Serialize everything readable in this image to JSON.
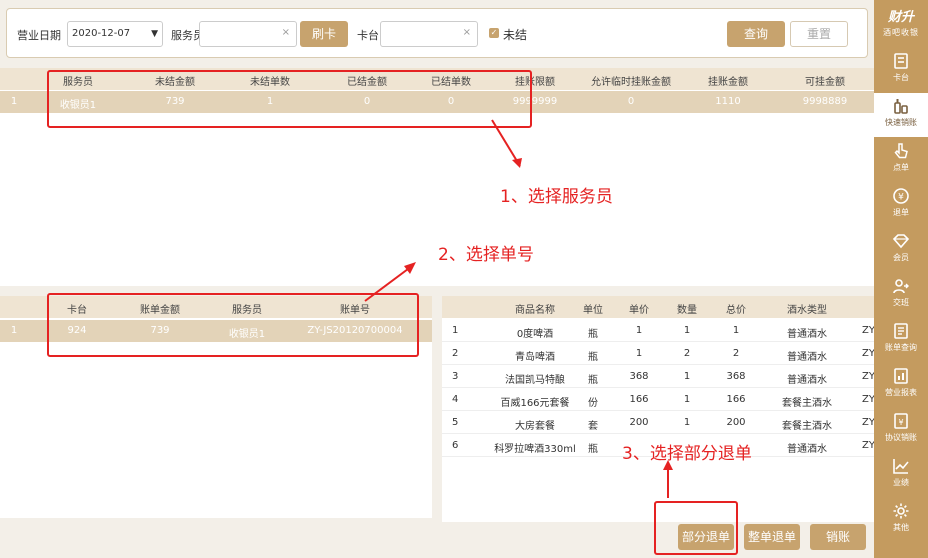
{
  "filter": {
    "date_label": "营业日期",
    "date_value": "2020-12-07",
    "waiter_label": "服务员",
    "waiter_clear": "×",
    "swipe_label": "刷卡",
    "card_label": "卡台",
    "card_clear": "×",
    "unsettled_label": "未结",
    "query_label": "查询",
    "reset_label": "重置"
  },
  "waiter_table": {
    "headers": [
      "服务员",
      "未结金额",
      "未结单数",
      "已结金额",
      "已结单数",
      "挂账限额",
      "允许临时挂账金额",
      "挂账金额",
      "可挂金额"
    ],
    "rows": [
      {
        "no": "1",
        "cells": [
          "收银员1",
          "739",
          "1",
          "0",
          "0",
          "9999999",
          "0",
          "1110",
          "9998889"
        ]
      }
    ]
  },
  "bill_table": {
    "headers": [
      "卡台",
      "账单金额",
      "服务员",
      "账单号"
    ],
    "rows": [
      {
        "no": "1",
        "cells": [
          "924",
          "739",
          "收银员1",
          "ZY-JS20120700004"
        ]
      }
    ]
  },
  "item_table": {
    "headers": [
      "商品名称",
      "单位",
      "单价",
      "数量",
      "总价",
      "酒水类型"
    ],
    "rows": [
      {
        "no": "1",
        "cells": [
          "0度啤酒",
          "瓶",
          "1",
          "1",
          "1",
          "普通酒水"
        ],
        "tail": "ZY"
      },
      {
        "no": "2",
        "cells": [
          "青岛啤酒",
          "瓶",
          "1",
          "2",
          "2",
          "普通酒水"
        ],
        "tail": "ZY"
      },
      {
        "no": "3",
        "cells": [
          "法国凯马特酿",
          "瓶",
          "368",
          "1",
          "368",
          "普通酒水"
        ],
        "tail": "ZY"
      },
      {
        "no": "4",
        "cells": [
          "百威166元套餐",
          "份",
          "166",
          "1",
          "166",
          "套餐主酒水"
        ],
        "tail": "ZY"
      },
      {
        "no": "5",
        "cells": [
          "大房套餐",
          "套",
          "200",
          "1",
          "200",
          "套餐主酒水"
        ],
        "tail": "ZY"
      },
      {
        "no": "6",
        "cells": [
          "科罗拉啤酒330ml",
          "瓶",
          "",
          "",
          "",
          "普通酒水"
        ],
        "tail": "ZY"
      }
    ]
  },
  "actions": {
    "partial_refund": "部分退单",
    "full_refund": "整单退单",
    "sell_off": "销账"
  },
  "sidebar": {
    "brand": "财升",
    "brand_sub": "酒吧收银",
    "items": [
      {
        "label": "卡台",
        "icon": "table-icon"
      },
      {
        "label": "快速销账",
        "icon": "bottles-icon"
      },
      {
        "label": "点单",
        "icon": "hand-pointer-icon"
      },
      {
        "label": "退单",
        "icon": "refund-yen-icon"
      },
      {
        "label": "会员",
        "icon": "diamond-icon"
      },
      {
        "label": "交班",
        "icon": "shift-users-icon"
      },
      {
        "label": "账单查询",
        "icon": "bill-query-icon"
      },
      {
        "label": "营业报表",
        "icon": "report-icon"
      },
      {
        "label": "协议销账",
        "icon": "agreement-yen-icon"
      },
      {
        "label": "业绩",
        "icon": "trend-chart-icon"
      },
      {
        "label": "其他",
        "icon": "gear-icon"
      }
    ],
    "active_index": 1
  },
  "annotations": {
    "step1": "1、选择服务员",
    "step2": "2、选择单号",
    "step3": "3、选择部分退单"
  },
  "colors": {
    "accent": "#c49b5f",
    "button": "#c7a36e",
    "selected_row": "#e3d3b8",
    "annotation": "#e52222"
  }
}
